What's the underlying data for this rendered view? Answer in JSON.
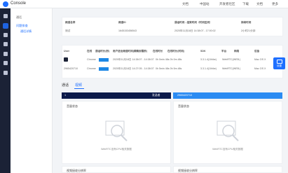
{
  "app": {
    "name": "Console"
  },
  "topnav": [
    "文档",
    "中国站",
    "开发者社区",
    "下载",
    "文档",
    "更多"
  ],
  "subnav": {
    "item_top": "通话",
    "group": "问题排查",
    "active": "通话详情"
  },
  "session_table": {
    "headers": [
      "频道名称",
      "频道ID",
      "通话时间 - 结束时间（时间区间）",
      "持续时间"
    ],
    "values": [
      "测试",
      "1645153456543",
      "2020年11月18日 14:38:07 - 17:00:02",
      "2小时21分钟"
    ]
  },
  "users_table": {
    "headers": [
      "User",
      "在线",
      "通话时长(秒)",
      "用户进出频道时间(精确到毫秒)",
      "在线时长",
      "在线时长(时间)",
      "SDK",
      "平台",
      "网络",
      "设备"
    ],
    "rows": [
      {
        "user": "",
        "status": "Chrome",
        "time": "2020年11月18日 14:38:07 - 14:38:07",
        "duration": "0h 0min 48s 0h 0m 48s",
        "sdk": "3.3.1.4(1/hike)",
        "platform": "WebRTC",
        "network": "WebRTC(WEB.)",
        "device": "Mac OS X"
      },
      {
        "user": "2965420710",
        "status": "Chrome",
        "time": "2020年11月18日 14:27:05 - 14:38:07",
        "duration": "0h 5min 48s 0h 5m 48s",
        "sdk": "3.3.1.4(1/hike)",
        "platform": "WebRTC",
        "network": "WebRTC(WEB.)",
        "device": "Mac OS X"
      }
    ]
  },
  "float_button": "设置",
  "tabs": [
    "通话",
    "视频"
  ],
  "bar_left": {
    "num": "1",
    "action": "发送者"
  },
  "bar_right": {
    "label": "2965420710"
  },
  "panels": [
    {
      "title": "音量状态",
      "empty": "WebRTC没有CPU相关数据"
    },
    {
      "title": "音量状态",
      "empty": "WebRTC没有CPU相关数据"
    },
    {
      "title": "视频接收分辨率",
      "empty": ""
    },
    {
      "title": "视频接收分辨率",
      "empty": ""
    }
  ],
  "colors": {
    "brand": "#1e6fff",
    "rail": "#1b2236",
    "bar_dark": "#0c1a4a",
    "bar_blue": "#2b8bf2"
  }
}
